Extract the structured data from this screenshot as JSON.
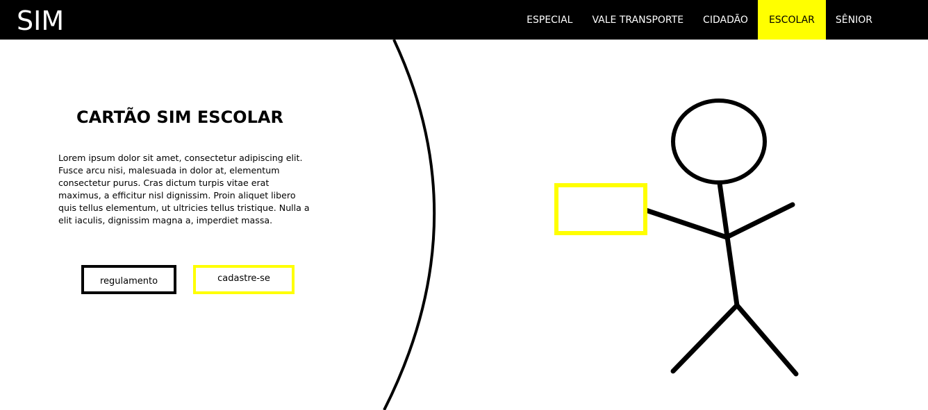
{
  "header": {
    "logo": "SIM",
    "nav": [
      {
        "label": "ESPECIAL"
      },
      {
        "label": "VALE TRANSPORTE"
      },
      {
        "label": "CIDADÃO"
      },
      {
        "label": "ESCOLAR",
        "active": true
      },
      {
        "label": "SÊNIOR"
      }
    ]
  },
  "main": {
    "title": "CARTÃO SIM ESCOLAR",
    "description": "Lorem ipsum dolor sit amet, consectetur adipiscing elit. Fusce arcu nisi, malesuada in dolor at, elementum consectetur purus. Cras dictum turpis vitae erat maximus, a efficitur nisl dignissim. Proin aliquet libero quis tellus elementum, ut ultricies tellus tristique. Nulla a elit iaculis, dignissim magna a, imperdiet massa.",
    "buttons": {
      "regulamento": "regulamento",
      "cadastre": "cadastre-se"
    }
  },
  "illustration": {
    "figure": "stick-figure-holding-card",
    "card_color": "#ffff00"
  },
  "colors": {
    "header_bg": "#000000",
    "accent": "#ffff00",
    "text": "#000000",
    "background": "#ffffff"
  }
}
